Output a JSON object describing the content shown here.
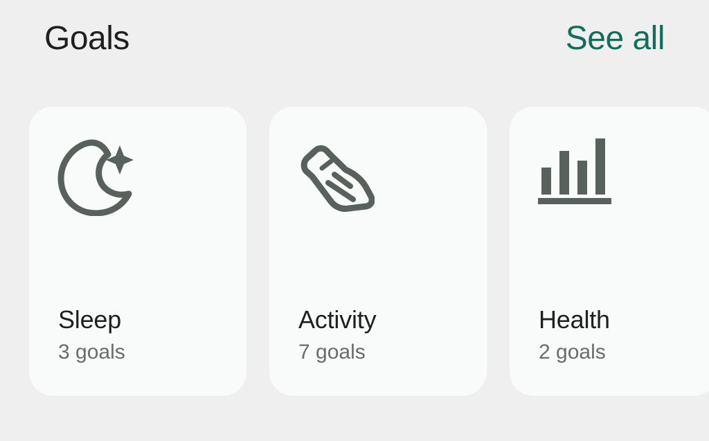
{
  "header": {
    "title": "Goals",
    "see_all_label": "See all"
  },
  "cards": [
    {
      "title": "Sleep",
      "subtitle": "3 goals",
      "icon": "moon-star-icon"
    },
    {
      "title": "Activity",
      "subtitle": "7 goals",
      "icon": "shoe-icon"
    },
    {
      "title": "Health",
      "subtitle": "2 goals",
      "icon": "bar-chart-icon"
    }
  ],
  "colors": {
    "background": "#efefef",
    "card": "#f8fbfa",
    "text": "#1f1f1f",
    "muted_text": "#6b6b6b",
    "accent": "#0f6e5c",
    "icon": "#59615d"
  }
}
